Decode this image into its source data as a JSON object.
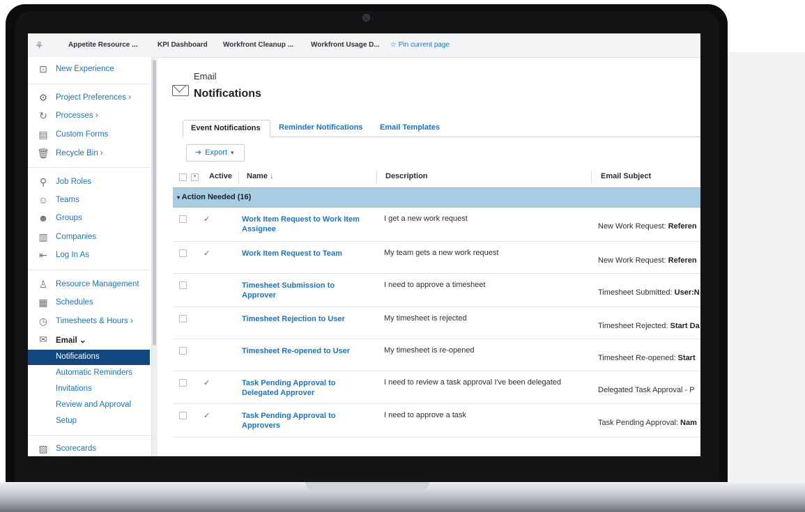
{
  "pinbar": {
    "items": [
      "Appetite Resource ...",
      "KPI Dashboard",
      "Workfront Cleanup ...",
      "Workfront Usage D..."
    ],
    "pin_current": "Pin current page"
  },
  "sidebar": {
    "new_experience": "New Experience",
    "project_preferences": "Project Preferences ›",
    "processes": "Processes ›",
    "custom_forms": "Custom Forms",
    "recycle_bin": "Recycle Bin ›",
    "job_roles": "Job Roles",
    "teams": "Teams",
    "groups": "Groups",
    "companies": "Companies",
    "log_in_as": "Log In As",
    "resource_management": "Resource Management",
    "schedules": "Schedules",
    "timesheets_hours": "Timesheets & Hours ›",
    "email": "Email ⌄",
    "email_sub": [
      "Notifications",
      "Automatic Reminders",
      "Invitations",
      "Review and Approval",
      "Setup"
    ],
    "scorecards": "Scorecards"
  },
  "page": {
    "title_sub": "Email",
    "title_main": "Notifications"
  },
  "tabs": [
    "Event Notifications",
    "Reminder Notifications",
    "Email Templates"
  ],
  "toolbar": {
    "export_label": "Export"
  },
  "table": {
    "headers": {
      "active": "Active",
      "name": "Name",
      "description": "Description",
      "email_subject": "Email Subject"
    },
    "group_label": "Action Needed (16)",
    "rows": [
      {
        "active": "✓",
        "name": "Work Item Request to Work Item Assignee",
        "description": "I get a new work request",
        "subject_prefix": "New Work Request: ",
        "subject_bold": "Referen"
      },
      {
        "active": "✓",
        "name": "Work Item Request to Team",
        "description": "My team gets a new work request",
        "subject_prefix": "New Work Request: ",
        "subject_bold": "Referen"
      },
      {
        "active": "",
        "name": "Timesheet Submission to Approver",
        "description": "I need to approve a timesheet",
        "subject_prefix": "Timesheet Submitted: ",
        "subject_bold": "User:N"
      },
      {
        "active": "",
        "name": "Timesheet Rejection to User",
        "description": "My timesheet is rejected",
        "subject_prefix": "Timesheet Rejected: ",
        "subject_bold": "Start Da"
      },
      {
        "active": "",
        "name": "Timesheet Re-opened to User",
        "description": "My timesheet is re-opened",
        "subject_prefix": "Timesheet Re-opened: ",
        "subject_bold": "Start"
      },
      {
        "active": "✓",
        "name": "Task Pending Approval to Delegated Approver",
        "description": "I need to review a task approval I've been delegated",
        "subject_prefix": "Delegated Task Approval - P",
        "subject_bold": ""
      },
      {
        "active": "✓",
        "name": "Task Pending Approval to Approvers",
        "description": "I need to approve a task",
        "subject_prefix": "Task Pending Approval: ",
        "subject_bold": "Nam"
      }
    ]
  },
  "colors": {
    "link": "#1a73c7",
    "active_nav": "#12477f",
    "group_header": "#a7cde3"
  }
}
